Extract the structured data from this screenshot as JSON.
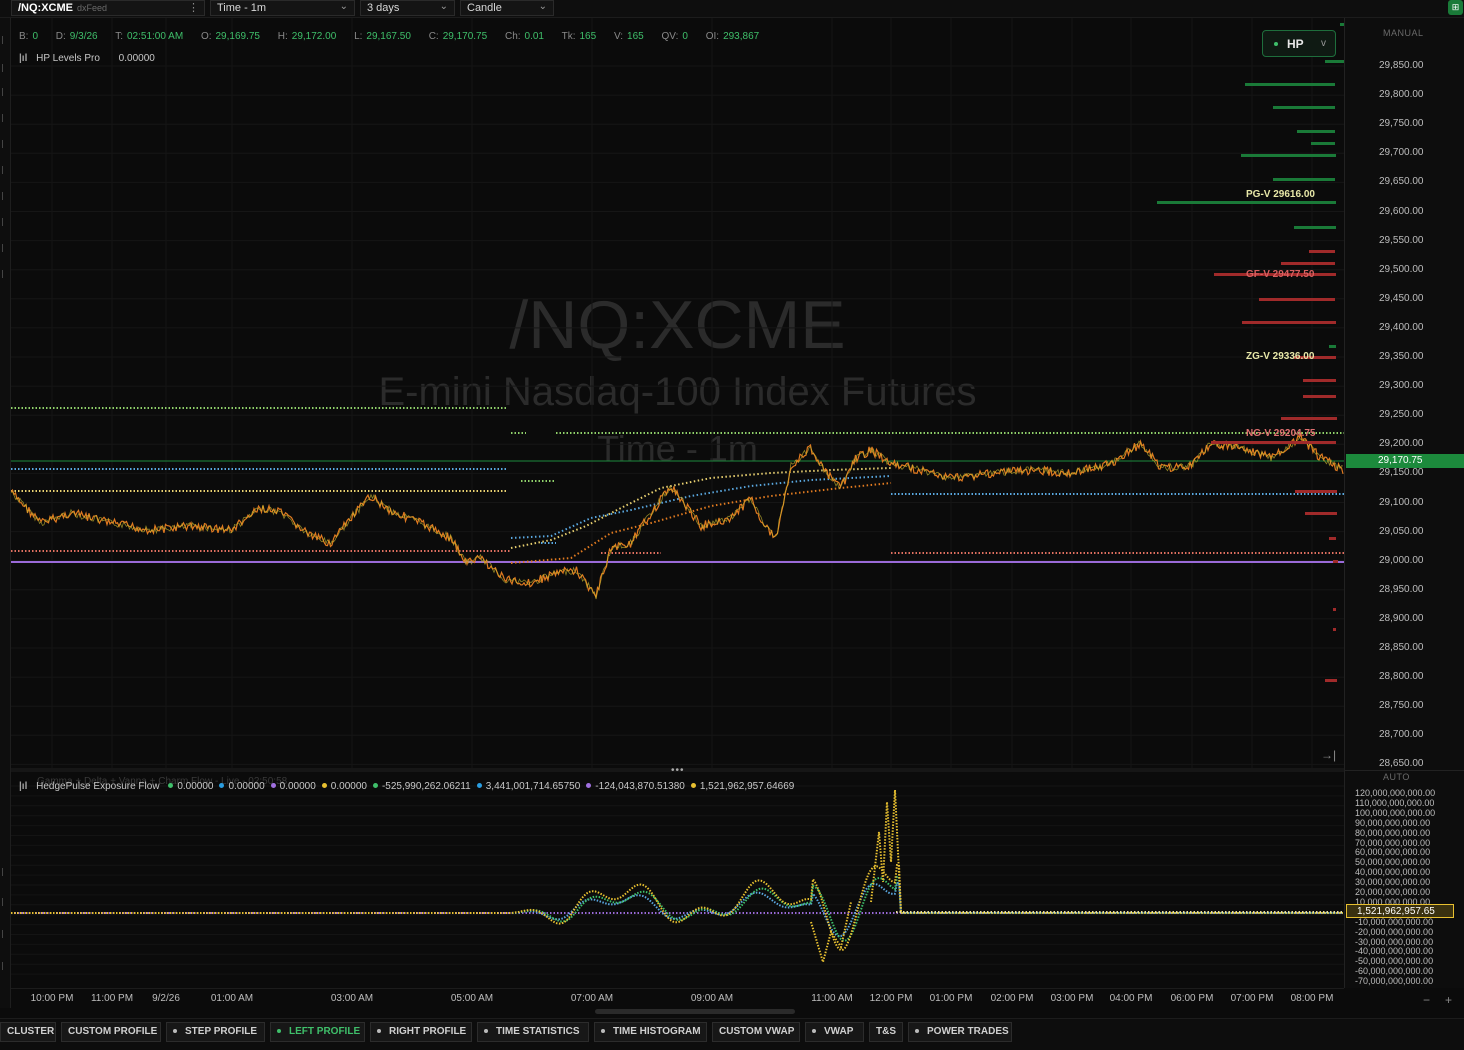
{
  "toolbar": {
    "symbol": "/NQ:XCME",
    "feed": "dxFeed",
    "timeframe": "Time - 1m",
    "period": "3 days",
    "chart_style": "Candle",
    "corner_icon": "layout-icon"
  },
  "ohlc": {
    "b_label": "B:",
    "b": "0",
    "d_label": "D:",
    "d": "9/3/26",
    "t_label": "T:",
    "t": "02:51:00 AM",
    "o_label": "O:",
    "o": "29,169.75",
    "h_label": "H:",
    "h": "29,172.00",
    "l_label": "L:",
    "l": "29,167.50",
    "c_label": "C:",
    "c": "29,170.75",
    "ch_label": "Ch:",
    "ch": "0.01",
    "tk_label": "Tk:",
    "tk": "165",
    "v_label": "V:",
    "v": "165",
    "qv_label": "QV:",
    "qv": "0",
    "oi_label": "OI:",
    "oi": "293,867"
  },
  "indicator": {
    "name": "HP Levels Pro",
    "value": "0.00000"
  },
  "hp_button": {
    "label": "HP",
    "caret": "v"
  },
  "watermark": {
    "symbol": "/NQ:XCME",
    "description": "E-mini Nasdaq-100 Index Futures",
    "timeframe": "Time - 1m"
  },
  "levels": [
    {
      "label": "PG-V 29616.00",
      "color": "#e8e8a8"
    },
    {
      "label": "GF-V 29477.50",
      "color": "#d86060"
    },
    {
      "label": "ZG-V 29336.00",
      "color": "#e8e8a8"
    },
    {
      "label": "NG-V 29204.75",
      "color": "#e07070"
    }
  ],
  "price_axis": {
    "mode": "MANUAL",
    "labels": [
      "29,850.00",
      "29,800.00",
      "29,750.00",
      "29,700.00",
      "29,650.00",
      "29,600.00",
      "29,550.00",
      "29,500.00",
      "29,450.00",
      "29,400.00",
      "29,350.00",
      "29,300.00",
      "29,250.00",
      "29,200.00",
      "29,150.00",
      "29,100.00",
      "29,050.00",
      "29,000.00",
      "28,950.00",
      "28,900.00",
      "28,850.00",
      "28,800.00",
      "28,750.00",
      "28,700.00",
      "28,650.00"
    ],
    "current_price": "29,170.75",
    "current_color": "#1c8a3c",
    "goto_end_icon": "jump-to-end-icon"
  },
  "sub_panel": {
    "mode": "AUTO",
    "ghost_legend": "Gamma + Delta + Vanna + Charm Flow - Live - 02:50:58",
    "name": "HedgePulse Exposure Flow",
    "items": [
      {
        "value": "0.00000",
        "color": "#3fbf6a"
      },
      {
        "value": "0.00000",
        "color": "#2a9de0"
      },
      {
        "value": "0.00000",
        "color": "#a070e0"
      },
      {
        "value": "0.00000",
        "color": "#e8c030"
      },
      {
        "value": "-525,990,262.06211",
        "color": "#3fbf6a"
      },
      {
        "value": "3,441,001,714.65750",
        "color": "#2a9de0"
      },
      {
        "value": "-124,043,870.51380",
        "color": "#a070e0"
      },
      {
        "value": "1,521,962,957.64669",
        "color": "#e8c030"
      }
    ],
    "axis_labels": [
      "120,000,000,000.00",
      "110,000,000,000.00",
      "100,000,000,000.00",
      "90,000,000,000.00",
      "80,000,000,000.00",
      "70,000,000,000.00",
      "60,000,000,000.00",
      "50,000,000,000.00",
      "40,000,000,000.00",
      "30,000,000,000.00",
      "20,000,000,000.00",
      "10,000,000,000.00",
      "-10,000,000,000.00",
      "-20,000,000,000.00",
      "-30,000,000,000.00",
      "-40,000,000,000.00",
      "-50,000,000,000.00",
      "-60,000,000,000.00",
      "-70,000,000,000.00"
    ],
    "current_value": "1,521,962,957.65",
    "current_color": "#e8c030"
  },
  "time_axis": {
    "labels": [
      "10:00 PM",
      "11:00 PM",
      "9/2/26",
      "01:00 AM",
      "03:00 AM",
      "05:00 AM",
      "07:00 AM",
      "09:00 AM",
      "11:00 AM",
      "12:00 PM",
      "01:00 PM",
      "02:00 PM",
      "03:00 PM",
      "04:00 PM",
      "06:00 PM",
      "07:00 PM",
      "08:00 PM"
    ]
  },
  "bottom_tabs": [
    {
      "label": "CLUSTER",
      "dot": false,
      "active": false
    },
    {
      "label": "CUSTOM PROFILE",
      "dot": false,
      "active": false
    },
    {
      "label": "STEP PROFILE",
      "dot": true,
      "active": false
    },
    {
      "label": "LEFT PROFILE",
      "dot": true,
      "active": true
    },
    {
      "label": "RIGHT PROFILE",
      "dot": true,
      "active": false
    },
    {
      "label": "TIME STATISTICS",
      "dot": true,
      "active": false
    },
    {
      "label": "TIME HISTOGRAM",
      "dot": true,
      "active": false
    },
    {
      "label": "CUSTOM VWAP",
      "dot": false,
      "active": false
    },
    {
      "label": "VWAP",
      "dot": true,
      "active": false
    },
    {
      "label": "T&S",
      "dot": false,
      "active": false
    },
    {
      "label": "POWER TRADES",
      "dot": true,
      "active": false
    }
  ],
  "colors": {
    "green": "#3fbf6a",
    "red": "#c23a3a",
    "orange": "#e07a20",
    "yellow": "#e8c030",
    "blue": "#5aa8e0",
    "purple": "#9a6ad8",
    "bg": "#0b0b0b"
  }
}
